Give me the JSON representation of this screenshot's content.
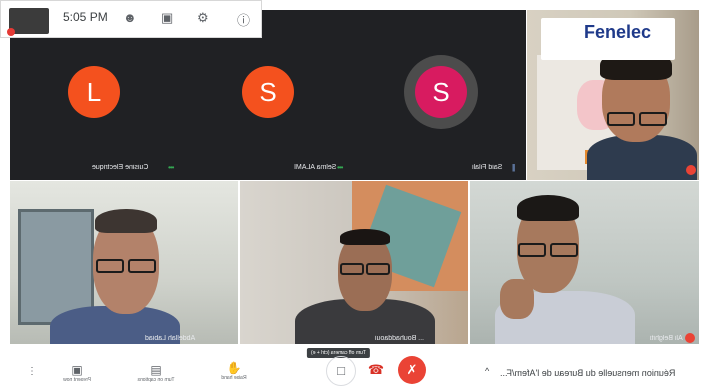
{
  "topbar": {
    "time": "5:05 PM"
  },
  "participants": [
    {
      "name": "Cuisine Electrique",
      "initial": "L",
      "color": "#f4511e"
    },
    {
      "name": "Selma ALAMI",
      "initial": "S",
      "color": "#f4511e"
    },
    {
      "name": "Said Filali",
      "initial": "S",
      "color": "#d81b60"
    }
  ],
  "video_tiles": {
    "top_right": {
      "banner_word": "Fenelec"
    },
    "bottom_left": {
      "name": "Abdellah Labiad"
    },
    "bottom_center": {
      "name": "... Bouhaddaoui"
    },
    "bottom_right": {
      "name": "Ali Belghiti"
    }
  },
  "bottombar": {
    "present_now": "Present now",
    "turn_on_captions": "Turn on captions",
    "raise_hand": "Raise hand",
    "tooltip": "Turn off camera (ctrl + e)",
    "meeting_title": "Réunion mensuelle du Bureau de l'Afem/F..."
  }
}
